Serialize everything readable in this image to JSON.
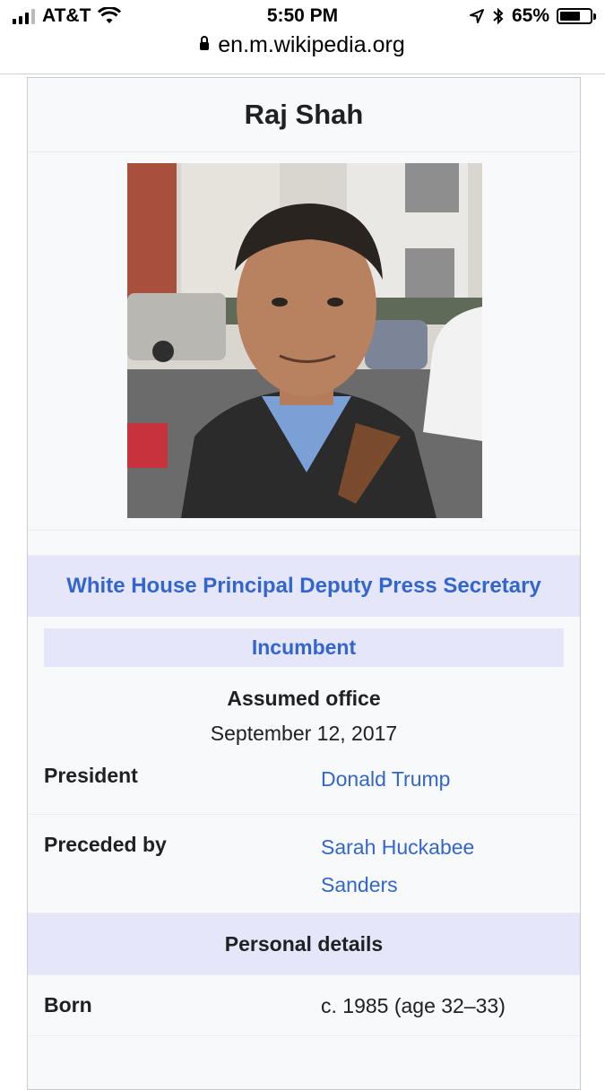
{
  "status_bar": {
    "carrier": "AT&T",
    "time": "5:50 PM",
    "battery": "65%",
    "battery_level": 0.65
  },
  "url_bar": {
    "url": "en.m.wikipedia.org"
  },
  "infobox": {
    "title": "Raj Shah",
    "office": "White House Principal Deputy Press Secretary",
    "incumbent_label": "Incumbent",
    "assumed_label": "Assumed office",
    "assumed_date": "September 12, 2017",
    "rows": [
      {
        "label": "President",
        "value": "Donald Trump"
      },
      {
        "label": "Preceded by",
        "value_line1": "Sarah Huckabee",
        "value_line2": "Sanders"
      }
    ],
    "section": "Personal details",
    "born_label": "Born",
    "born_value": "c. 1985 (age 32–33)"
  },
  "colors": {
    "link": "#3366cc",
    "header_bg": "#e6e6fa",
    "infobox_bg": "#f8f9fa"
  }
}
